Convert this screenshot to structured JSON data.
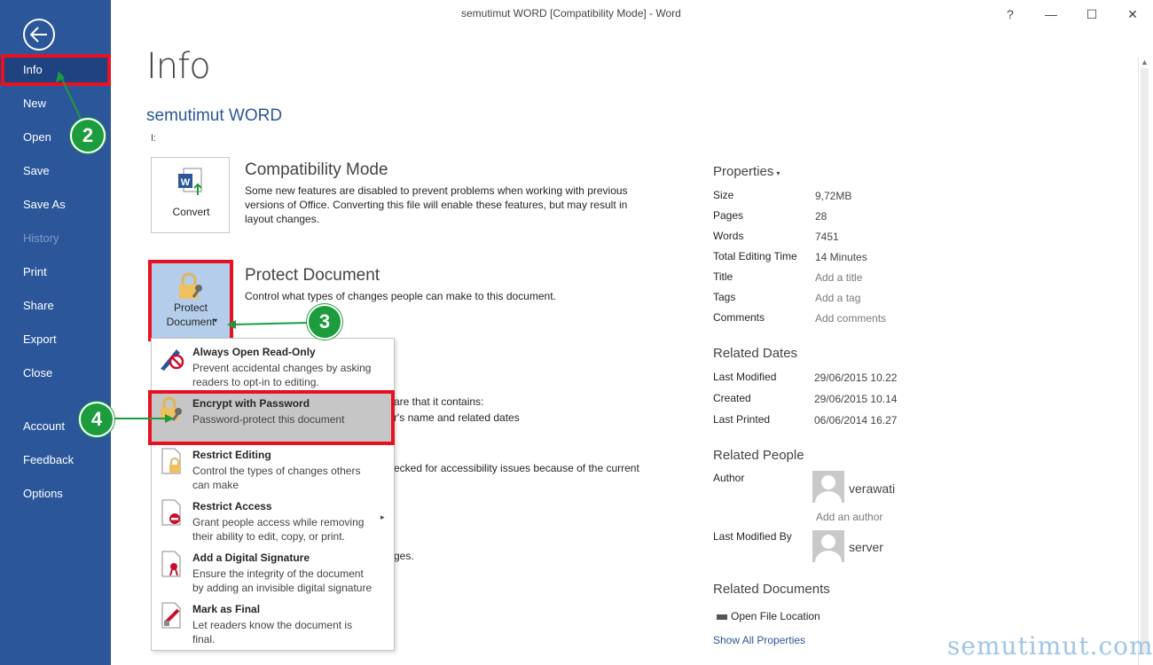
{
  "window": {
    "title": "semutimut WORD [Compatibility Mode]  -  Word",
    "help": "?",
    "minimize": "—",
    "maximize": "☐",
    "close": "✕"
  },
  "sidebar": {
    "items": [
      {
        "label": "Info"
      },
      {
        "label": "New"
      },
      {
        "label": "Open"
      },
      {
        "label": "Save"
      },
      {
        "label": "Save As"
      },
      {
        "label": "History"
      },
      {
        "label": "Print"
      },
      {
        "label": "Share"
      },
      {
        "label": "Export"
      },
      {
        "label": "Close"
      },
      {
        "label": "Account"
      },
      {
        "label": "Feedback"
      },
      {
        "label": "Options"
      }
    ]
  },
  "main": {
    "title": "Info",
    "doc_name": "semutimut WORD",
    "doc_path": "I:",
    "compat": {
      "button": "Convert",
      "heading": "Compatibility Mode",
      "desc1": "Some new features are disabled to prevent problems when working with previous",
      "desc2": "versions of Office. Converting this file will enable these features, but may result in",
      "desc3": "layout changes."
    },
    "protect": {
      "button1": "Protect",
      "button2": "Document",
      "heading": "Protect Document",
      "desc": "Control what types of changes people can make to this document."
    },
    "hidden_text": {
      "t1": "are that it contains:",
      "t2": "r's name and related dates",
      "t3": "ecked for accessibility issues because of the current",
      "t4": "ges."
    }
  },
  "menu": {
    "items": [
      {
        "title": "Always Open Read-Only",
        "desc1": "Prevent accidental changes by asking",
        "desc2": "readers to opt-in to editing."
      },
      {
        "title": "Encrypt with Password",
        "desc1": "Password-protect this document",
        "desc2": ""
      },
      {
        "title": "Restrict Editing",
        "desc1": "Control the types of changes others",
        "desc2": "can make"
      },
      {
        "title": "Restrict Access",
        "desc1": "Grant people access while removing",
        "desc2": "their ability to edit, copy, or print."
      },
      {
        "title": "Add a Digital Signature",
        "desc1": "Ensure the integrity of the document",
        "desc2": "by adding an invisible digital signature"
      },
      {
        "title": "Mark as Final",
        "desc1": "Let readers know the document is",
        "desc2": "final."
      }
    ]
  },
  "properties": {
    "heading": "Properties",
    "rows": [
      {
        "label": "Size",
        "value": "9,72MB"
      },
      {
        "label": "Pages",
        "value": "28"
      },
      {
        "label": "Words",
        "value": "7451"
      },
      {
        "label": "Total Editing Time",
        "value": "14 Minutes"
      },
      {
        "label": "Title",
        "value": "Add a title"
      },
      {
        "label": "Tags",
        "value": "Add a tag"
      },
      {
        "label": "Comments",
        "value": "Add comments"
      }
    ]
  },
  "related_dates": {
    "heading": "Related Dates",
    "rows": [
      {
        "label": "Last Modified",
        "value": "29/06/2015 10.22"
      },
      {
        "label": "Created",
        "value": "29/06/2015 10.14"
      },
      {
        "label": "Last Printed",
        "value": "06/06/2014 16.27"
      }
    ]
  },
  "related_people": {
    "heading": "Related People",
    "author_label": "Author",
    "author_name": "verawati",
    "add_author": "Add an author",
    "modified_label": "Last Modified By",
    "modified_name": "server"
  },
  "related_docs": {
    "heading": "Related Documents",
    "open_location": "Open File Location",
    "show_all": "Show All Properties"
  },
  "markers": {
    "m2": "2",
    "m3": "3",
    "m4": "4"
  },
  "watermark": "semutimut.com",
  "colors": {
    "sidebar": "#2b579a",
    "accent_red": "#e81123",
    "marker_green": "#1c9c3c"
  }
}
